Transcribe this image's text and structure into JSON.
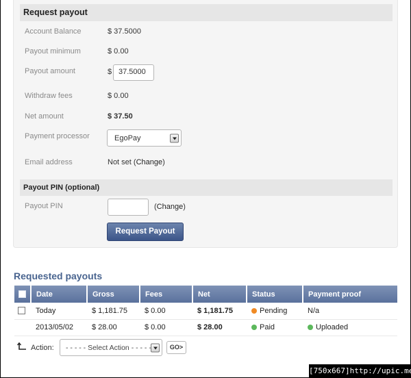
{
  "request_payout": {
    "heading": "Request payout",
    "rows": [
      {
        "label": "Account Balance",
        "value": "$ 37.5000"
      },
      {
        "label": "Payout minimum",
        "value": "$ 0.00"
      },
      {
        "label": "Payout amount",
        "currency": "$",
        "input_value": "37.5000"
      },
      {
        "label": "Withdraw fees",
        "value": "$ 0.00"
      },
      {
        "label": "Net amount",
        "value": "$ 37.50"
      },
      {
        "label": "Payment processor",
        "selected": "EgoPay"
      },
      {
        "label": "Email address",
        "value_prefix": "Not set (",
        "link": "Change",
        "value_suffix": ")"
      }
    ]
  },
  "payout_pin": {
    "heading": "Payout PIN (optional)",
    "label": "Payout PIN",
    "input_value": "",
    "link_prefix": "(",
    "link": "Change",
    "link_suffix": ")"
  },
  "submit_button": "Request Payout",
  "requested_payouts": {
    "title": "Requested payouts",
    "columns": [
      "Date",
      "Gross",
      "Fees",
      "Net",
      "Status",
      "Payment proof"
    ],
    "rows": [
      {
        "date": "Today",
        "gross": "$ 1,181.75",
        "fees": "$ 0.00",
        "net": "$ 1,181.75",
        "status": "Pending",
        "status_color": "#f08a24",
        "proof": "N/a",
        "has_checkbox": true
      },
      {
        "date": "2013/05/02",
        "gross": "$ 28.00",
        "fees": "$ 0.00",
        "net": "$ 28.00",
        "status": "Paid",
        "status_color": "#5cb85c",
        "proof": "Uploaded",
        "proof_color": "#5cb85c",
        "has_checkbox": false
      }
    ]
  },
  "action_bar": {
    "label": "Action:",
    "select_placeholder": "- - - - - Select Action - - - - -",
    "go_label": "GO>"
  },
  "watermark": "[750x667]http://upic.me/"
}
